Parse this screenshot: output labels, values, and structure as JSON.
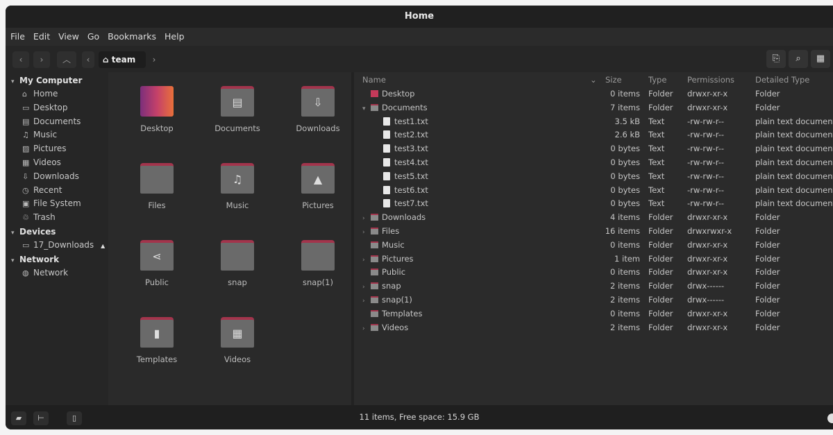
{
  "window": {
    "title": "Home"
  },
  "menu": [
    "File",
    "Edit",
    "View",
    "Go",
    "Bookmarks",
    "Help"
  ],
  "toolbar": {
    "path_label": "team"
  },
  "sidebar": {
    "sections": [
      {
        "title": "My Computer",
        "items": [
          {
            "label": "Home",
            "icon": "home-icon",
            "glyph": "⌂"
          },
          {
            "label": "Desktop",
            "icon": "desktop-icon",
            "glyph": "▭"
          },
          {
            "label": "Documents",
            "icon": "documents-icon",
            "glyph": "▤"
          },
          {
            "label": "Music",
            "icon": "music-icon",
            "glyph": "♫"
          },
          {
            "label": "Pictures",
            "icon": "pictures-icon",
            "glyph": "▨"
          },
          {
            "label": "Videos",
            "icon": "videos-icon",
            "glyph": "▦"
          },
          {
            "label": "Downloads",
            "icon": "downloads-icon",
            "glyph": "⇩"
          },
          {
            "label": "Recent",
            "icon": "recent-icon",
            "glyph": "◷"
          },
          {
            "label": "File System",
            "icon": "file-system-icon",
            "glyph": "▣"
          },
          {
            "label": "Trash",
            "icon": "trash-icon",
            "glyph": "♲"
          }
        ]
      },
      {
        "title": "Devices",
        "items": [
          {
            "label": "17_Downloads",
            "icon": "drive-icon",
            "glyph": "▭",
            "eject": "▲"
          }
        ]
      },
      {
        "title": "Network",
        "items": [
          {
            "label": "Network",
            "icon": "network-icon",
            "glyph": "◍"
          }
        ]
      }
    ]
  },
  "icon_grid": [
    {
      "label": "Desktop",
      "glyph": ""
    },
    {
      "label": "Documents",
      "glyph": "▤"
    },
    {
      "label": "Downloads",
      "glyph": "⇩"
    },
    {
      "label": "Files",
      "glyph": ""
    },
    {
      "label": "Music",
      "glyph": "♫"
    },
    {
      "label": "Pictures",
      "glyph": "▲"
    },
    {
      "label": "Public",
      "glyph": "⋖"
    },
    {
      "label": "snap",
      "glyph": ""
    },
    {
      "label": "snap(1)",
      "glyph": ""
    },
    {
      "label": "Templates",
      "glyph": "▮"
    },
    {
      "label": "Videos",
      "glyph": "▦"
    }
  ],
  "list": {
    "columns": [
      "Name",
      "Size",
      "Type",
      "Permissions",
      "Detailed Type"
    ],
    "rows": [
      {
        "indent": 0,
        "expander": "",
        "icon": "folder-desktop",
        "name": "Desktop",
        "size": "0 items",
        "type": "Folder",
        "perm": "drwxr-xr-x",
        "dtype": "Folder"
      },
      {
        "indent": 0,
        "expander": "▾",
        "icon": "folder",
        "name": "Documents",
        "size": "7 items",
        "type": "Folder",
        "perm": "drwxr-xr-x",
        "dtype": "Folder"
      },
      {
        "indent": 1,
        "expander": "",
        "icon": "file",
        "name": "test1.txt",
        "size": "3.5 kB",
        "type": "Text",
        "perm": "-rw-rw-r--",
        "dtype": "plain text document"
      },
      {
        "indent": 1,
        "expander": "",
        "icon": "file",
        "name": "test2.txt",
        "size": "2.6 kB",
        "type": "Text",
        "perm": "-rw-rw-r--",
        "dtype": "plain text document"
      },
      {
        "indent": 1,
        "expander": "",
        "icon": "file",
        "name": "test3.txt",
        "size": "0 bytes",
        "type": "Text",
        "perm": "-rw-rw-r--",
        "dtype": "plain text document"
      },
      {
        "indent": 1,
        "expander": "",
        "icon": "file",
        "name": "test4.txt",
        "size": "0 bytes",
        "type": "Text",
        "perm": "-rw-rw-r--",
        "dtype": "plain text document"
      },
      {
        "indent": 1,
        "expander": "",
        "icon": "file",
        "name": "test5.txt",
        "size": "0 bytes",
        "type": "Text",
        "perm": "-rw-rw-r--",
        "dtype": "plain text document"
      },
      {
        "indent": 1,
        "expander": "",
        "icon": "file",
        "name": "test6.txt",
        "size": "0 bytes",
        "type": "Text",
        "perm": "-rw-rw-r--",
        "dtype": "plain text document"
      },
      {
        "indent": 1,
        "expander": "",
        "icon": "file",
        "name": "test7.txt",
        "size": "0 bytes",
        "type": "Text",
        "perm": "-rw-rw-r--",
        "dtype": "plain text document"
      },
      {
        "indent": 0,
        "expander": "›",
        "icon": "folder",
        "name": "Downloads",
        "size": "4 items",
        "type": "Folder",
        "perm": "drwxr-xr-x",
        "dtype": "Folder"
      },
      {
        "indent": 0,
        "expander": "›",
        "icon": "folder",
        "name": "Files",
        "size": "16 items",
        "type": "Folder",
        "perm": "drwxrwxr-x",
        "dtype": "Folder"
      },
      {
        "indent": 0,
        "expander": "",
        "icon": "folder",
        "name": "Music",
        "size": "0 items",
        "type": "Folder",
        "perm": "drwxr-xr-x",
        "dtype": "Folder"
      },
      {
        "indent": 0,
        "expander": "›",
        "icon": "folder",
        "name": "Pictures",
        "size": "1 item",
        "type": "Folder",
        "perm": "drwxr-xr-x",
        "dtype": "Folder"
      },
      {
        "indent": 0,
        "expander": "",
        "icon": "folder",
        "name": "Public",
        "size": "0 items",
        "type": "Folder",
        "perm": "drwxr-xr-x",
        "dtype": "Folder"
      },
      {
        "indent": 0,
        "expander": "›",
        "icon": "folder",
        "name": "snap",
        "size": "2 items",
        "type": "Folder",
        "perm": "drwx------",
        "dtype": "Folder"
      },
      {
        "indent": 0,
        "expander": "›",
        "icon": "folder",
        "name": "snap(1)",
        "size": "2 items",
        "type": "Folder",
        "perm": "drwx------",
        "dtype": "Folder"
      },
      {
        "indent": 0,
        "expander": "",
        "icon": "folder",
        "name": "Templates",
        "size": "0 items",
        "type": "Folder",
        "perm": "drwxr-xr-x",
        "dtype": "Folder"
      },
      {
        "indent": 0,
        "expander": "›",
        "icon": "folder",
        "name": "Videos",
        "size": "2 items",
        "type": "Folder",
        "perm": "drwxr-xr-x",
        "dtype": "Folder"
      }
    ]
  },
  "status": {
    "text": "11 items, Free space: 15.9 GB"
  },
  "colors": {
    "accent": "#a3344c",
    "window_bg": "#2b2b2b",
    "titlebar_bg": "#202020"
  }
}
